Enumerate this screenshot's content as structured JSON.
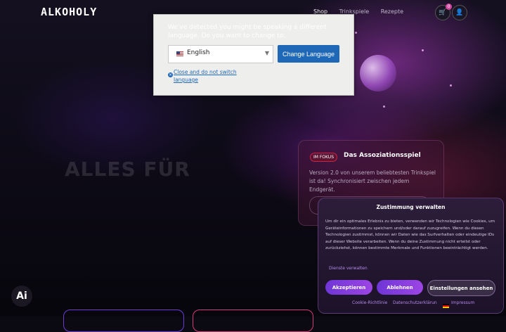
{
  "header": {
    "logo": "ALKOHOLY",
    "nav": [
      "Shop",
      "Trinkspiele",
      "Rezepte"
    ],
    "cart_count": "0",
    "cart_icon": "cart-icon",
    "user_icon": "user-icon"
  },
  "hero": {
    "title": "ALLES FÜR",
    "focus": {
      "badge": "IM FOKUS",
      "title": "Das Assoziationsspiel",
      "text": "Version 2.0 von unserem beliebtesten Trinkspiel ist da! Synchronisiert zwischen jedem Endgerät."
    }
  },
  "language_dialog": {
    "message": "We've detected you might be speaking a different language. Do you want to change to:",
    "selected_language": "English",
    "change_button": "Change Language",
    "close_link": "Close and do not switch language"
  },
  "consent": {
    "title": "Zustimmung verwalten",
    "text": "Um dir ein optimales Erlebnis zu bieten, verwenden wir Technologien wie Cookies, um Geräteinformationen zu speichern und/oder darauf zuzugreifen. Wenn du diesen Technologien zustimmst, können wir Daten wie das Surfverhalten oder eindeutige IDs auf dieser Website verarbeiten. Wenn du deine Zustimmung nicht erteilst oder zurückziehst, können bestimmte Merkmale und Funktionen beeinträchtigt werden.",
    "services_link": "Dienste verwalten",
    "accept": "Akzeptieren",
    "deny": "Ablehnen",
    "settings": "Einstellungen ansehen",
    "footer_links": [
      "Cookie-Richtlinie",
      "Datenschutzerklärun",
      "Impressum"
    ]
  },
  "ai_badge": "Ai"
}
